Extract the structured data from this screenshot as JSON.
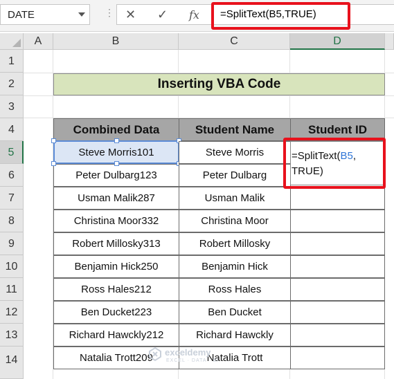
{
  "formula_bar": {
    "name_box": "DATE",
    "cancel_icon": "close-icon",
    "enter_icon": "check-icon",
    "function_icon": "fx",
    "formula": "=SplitText(B5,TRUE)"
  },
  "columns": [
    "A",
    "B",
    "C",
    "D"
  ],
  "rows": [
    "1",
    "2",
    "3",
    "4",
    "5",
    "6",
    "7",
    "8",
    "9",
    "10",
    "11",
    "12",
    "13",
    "14"
  ],
  "title": "Inserting VBA Code",
  "table": {
    "headers": [
      "Combined Data",
      "Student Name",
      "Student ID"
    ],
    "rows": [
      {
        "combined": "Steve Morris101",
        "name": "Steve Morris"
      },
      {
        "combined": "Peter Dulbarg123",
        "name": "Peter Dulbarg"
      },
      {
        "combined": "Usman Malik287",
        "name": "Usman Malik"
      },
      {
        "combined": "Christina Moor332",
        "name": "Christina Moor"
      },
      {
        "combined": "Robert Millosky313",
        "name": "Robert Millosky"
      },
      {
        "combined": "Benjamin Hick250",
        "name": "Benjamin Hick"
      },
      {
        "combined": "Ross Hales212",
        "name": "Ross Hales"
      },
      {
        "combined": "Ben Ducket223",
        "name": "Ben Ducket"
      },
      {
        "combined": "Richard Hawckly212",
        "name": "Richard Hawckly"
      },
      {
        "combined": "Natalia Trott209",
        "name": "Natalia Trott"
      }
    ]
  },
  "editing_cell": {
    "part1": "=SplitText(",
    "ref": "B5",
    "part2": ",",
    "line2": "TRUE)"
  },
  "watermark": {
    "brand": "exceldemy",
    "tagline": "EXCEL · DATA · BI"
  },
  "colors": {
    "highlight_red": "#e8111c",
    "title_fill": "#d8e4bc",
    "header_fill": "#a6a6a6",
    "reference_blue": "#2f75d6",
    "selection_green": "#217346"
  }
}
